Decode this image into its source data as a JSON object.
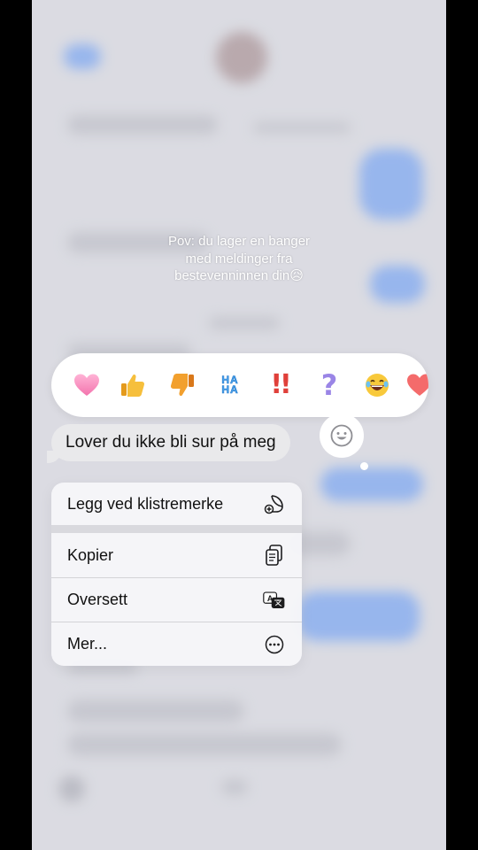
{
  "caption": {
    "line1": "Pov: du lager en banger",
    "line2": "med meldinger fra",
    "line3": "bestevenninnen din😥"
  },
  "reactions": [
    {
      "name": "heart",
      "glyph": "🩷"
    },
    {
      "name": "thumbs-up",
      "glyph": "👍"
    },
    {
      "name": "thumbs-down",
      "glyph": "👎"
    },
    {
      "name": "haha",
      "glyph": "HA HA"
    },
    {
      "name": "exclamation",
      "glyph": "‼"
    },
    {
      "name": "question",
      "glyph": "?"
    },
    {
      "name": "laughing",
      "glyph": "😂"
    },
    {
      "name": "heart-partial",
      "glyph": "❤️"
    }
  ],
  "message": {
    "text": "Lover du ikke bli sur på meg"
  },
  "menu": {
    "sticker_label": "Legg ved klistremerke",
    "copy_label": "Kopier",
    "translate_label": "Oversett",
    "more_label": "Mer..."
  },
  "colors": {
    "background": "#d7d8df",
    "bubble_gray": "#e9e9eb",
    "imessage_blue": "#6f9ef0"
  }
}
